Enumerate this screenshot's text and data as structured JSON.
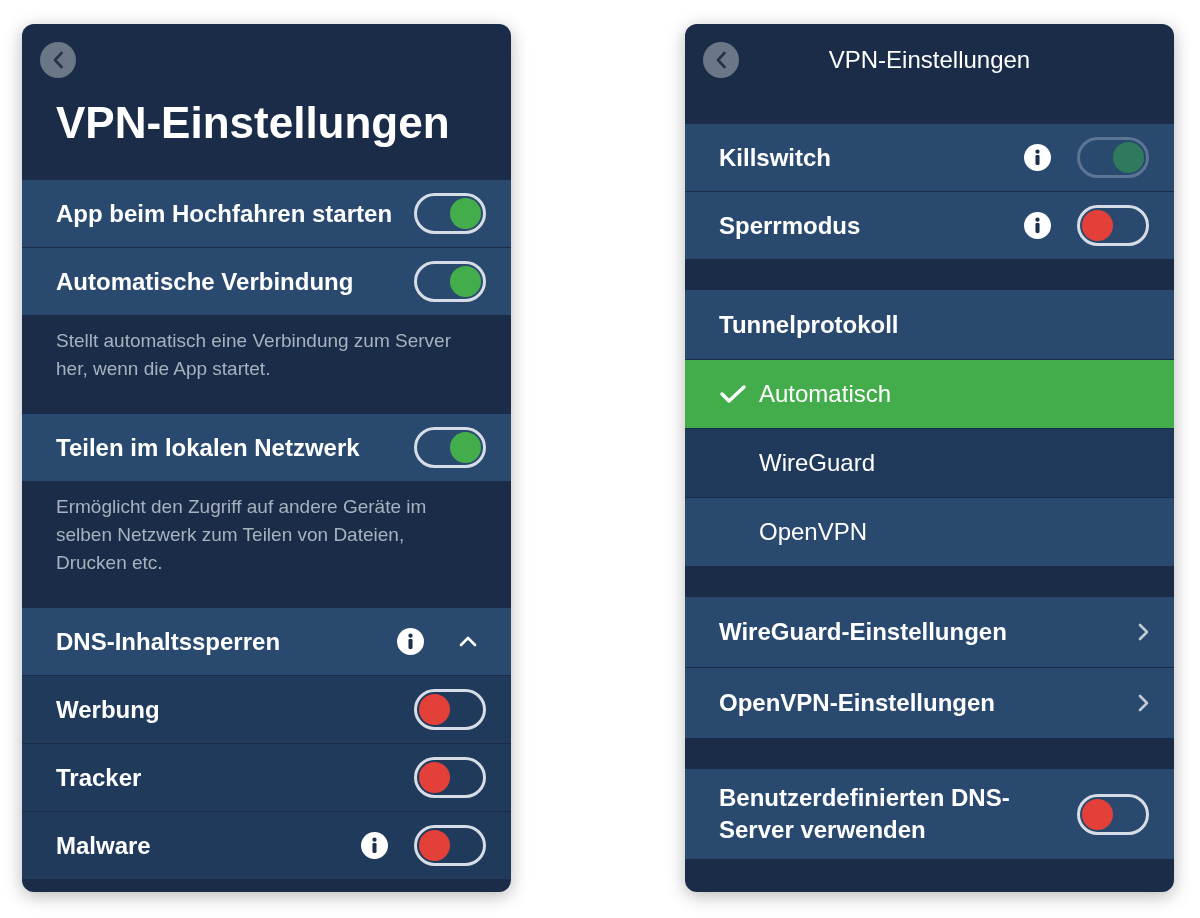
{
  "panels": [
    {
      "header": {
        "kind": "large",
        "title": "VPN-Einstellungen"
      },
      "groups": [
        [
          {
            "kind": "toggle",
            "label": "App beim Hochfahren starten",
            "info": false,
            "on": true,
            "disabled": false
          },
          {
            "kind": "toggle",
            "label": "Automatische Verbindung",
            "info": false,
            "on": true,
            "disabled": false
          },
          {
            "kind": "note",
            "text": "Stellt automatisch eine Verbindung zum Server her, wenn die App startet."
          },
          {
            "kind": "toggle",
            "label": "Teilen im lokalen Netzwerk",
            "info": false,
            "on": true,
            "disabled": false
          },
          {
            "kind": "note",
            "text": "Ermöglicht den Zugriff auf andere Geräte im selben Netzwerk zum Teilen von Dateien, Drucken etc."
          },
          {
            "kind": "expander",
            "label": "DNS-Inhaltssperren",
            "info": true,
            "expanded": true,
            "children": [
              {
                "kind": "toggle",
                "label": "Werbung",
                "info": false,
                "on": false,
                "disabled": false
              },
              {
                "kind": "toggle",
                "label": "Tracker",
                "info": false,
                "on": false,
                "disabled": false
              },
              {
                "kind": "toggle",
                "label": "Malware",
                "info": true,
                "on": false,
                "disabled": false
              }
            ]
          }
        ]
      ]
    },
    {
      "header": {
        "kind": "compact",
        "title": "VPN-Einstellungen"
      },
      "groups": [
        [
          {
            "kind": "toggle",
            "label": "Killswitch",
            "info": true,
            "on": true,
            "disabled": true
          },
          {
            "kind": "toggle",
            "label": "Sperrmodus",
            "info": true,
            "on": false,
            "disabled": false
          }
        ],
        [
          {
            "kind": "heading",
            "label": "Tunnelprotokoll"
          },
          {
            "kind": "option",
            "label": "Automatisch",
            "selected": true,
            "hovered": false
          },
          {
            "kind": "option",
            "label": "WireGuard",
            "selected": false,
            "hovered": false
          },
          {
            "kind": "option",
            "label": "OpenVPN",
            "selected": false,
            "hovered": true
          }
        ],
        [
          {
            "kind": "link",
            "label": "WireGuard-Einstellungen"
          },
          {
            "kind": "link",
            "label": "OpenVPN-Einstellungen"
          }
        ],
        [
          {
            "kind": "toggle",
            "label": "Benutzerdefinierten DNS-Server verwenden",
            "info": false,
            "on": false,
            "disabled": false
          }
        ]
      ]
    }
  ]
}
